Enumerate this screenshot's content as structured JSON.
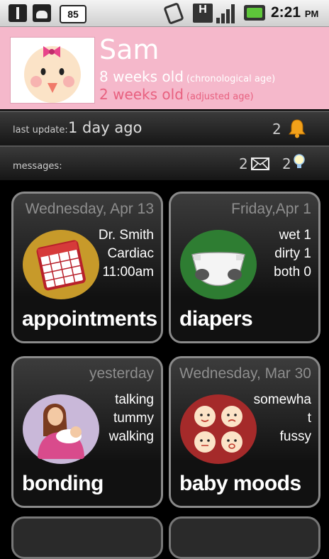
{
  "status_bar": {
    "battery_level": "85",
    "network_type": "H",
    "time": "2:21",
    "ampm": "PM",
    "icons": [
      "usb-icon",
      "android-debug-icon",
      "battery-percent-icon",
      "vibrate-icon",
      "network-h-icon",
      "signal-icon",
      "charging-battery-icon"
    ]
  },
  "profile": {
    "name": "Sam",
    "chronological_age": "8 weeks old",
    "chronological_label": "(chronological age)",
    "adjusted_age": "2 weeks old",
    "adjusted_label": "(adjusted age)"
  },
  "updates": {
    "label": "last update:",
    "value": "1 day ago",
    "alert_count": "2"
  },
  "messages": {
    "label": "messages:",
    "mail_count": "2",
    "tip_count": "2"
  },
  "tiles": [
    {
      "date": "Wednesday, Apr 13",
      "lines": [
        "Dr. Smith",
        "Cardiac",
        "11:00am"
      ],
      "title": "appointments"
    },
    {
      "date": "Friday,Apr 1",
      "lines": [
        "wet 1",
        "dirty 1",
        "both 0"
      ],
      "title": "diapers"
    },
    {
      "date": "yesterday",
      "lines": [
        "talking",
        "tummy",
        "walking"
      ],
      "title": "bonding"
    },
    {
      "date": "Wednesday, Mar 30",
      "lines": [
        "somewha",
        "t",
        "fussy"
      ],
      "title": "baby moods"
    }
  ],
  "colors": {
    "profile_bg": "#f5b8cb",
    "adjusted_text": "#e8607f",
    "tile_border": "#8a8a8a"
  }
}
